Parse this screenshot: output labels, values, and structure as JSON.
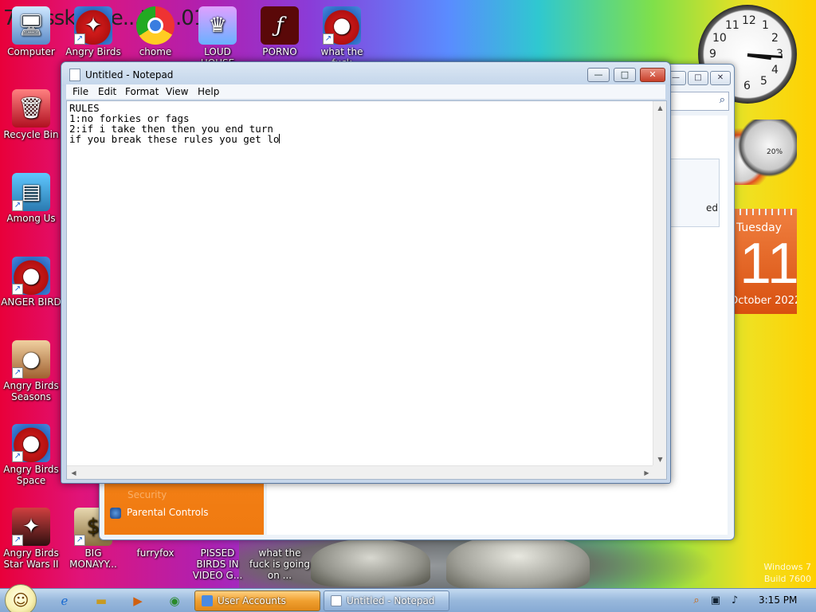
{
  "desktop": {
    "overlay_text": "7 Passkonae...tio...012",
    "icons": [
      {
        "label": "Computer",
        "icon": "computer-icon",
        "glyph": "🖥"
      },
      {
        "label": "Angry Birds",
        "icon": "angry-birds-star-wars-icon",
        "glyph": "✦",
        "badge": "STAR WARS"
      },
      {
        "label": "chome",
        "icon": "chrome-icon",
        "glyph": "◉"
      },
      {
        "label": "LOUD HOUSE",
        "icon": "loud-house-icon",
        "glyph": "♛"
      },
      {
        "label": "PORNO",
        "icon": "flash-icon",
        "glyph": "ƒ"
      },
      {
        "label": "what the fuck",
        "icon": "angry-birds-space-icon",
        "glyph": "●",
        "badge": "SPACE"
      },
      {
        "label": "Recycle Bin",
        "icon": "recycle-bin-icon",
        "glyph": "🗑"
      },
      {
        "label": "Among Us",
        "icon": "among-us-icon",
        "glyph": "▤"
      },
      {
        "label": "ANGER BIRD",
        "icon": "angry-birds-icon",
        "glyph": "●"
      },
      {
        "label": "Angry Birds Seasons",
        "icon": "angry-birds-seasons-icon",
        "glyph": "●",
        "badge": "SEASONS"
      },
      {
        "label": "Angry Birds Space",
        "icon": "angry-birds-space-icon",
        "glyph": "●",
        "badge": "SPACE"
      },
      {
        "label": "Angry Birds Star Wars II",
        "icon": "angry-birds-star-wars-2-icon",
        "glyph": "✦",
        "badge": "STAR WARS"
      },
      {
        "label": "BIG MONAYY...",
        "icon": "money-bag-icon",
        "glyph": "$"
      },
      {
        "label": "furryfox",
        "icon": "furryfox-icon",
        "glyph": "●"
      },
      {
        "label": "PISSED BIRDS IN VIDEO G...",
        "icon": "pissed-birds-icon",
        "glyph": "●"
      },
      {
        "label": "what the fuck is going on ...",
        "icon": "folder-icon",
        "glyph": "●"
      }
    ]
  },
  "gadgets": {
    "clock": {
      "numbers": [
        "12",
        "1",
        "2",
        "3",
        "4",
        "5",
        "6",
        "7",
        "8",
        "9",
        "10",
        "11"
      ]
    },
    "meter": {
      "percent": "20%"
    },
    "calendar": {
      "weekday": "Tuesday",
      "day": "11",
      "month_year": "October 2022"
    }
  },
  "back_window": {
    "side_link": "Parental Controls",
    "side_link_faded": "Security",
    "content_fragment": "ed"
  },
  "notepad": {
    "title": "Untitled - Notepad",
    "menu": [
      "File",
      "Edit",
      "Format",
      "View",
      "Help"
    ],
    "lines": [
      "RULES",
      "1:no forkies or fags",
      "2:if i take then then you end turn",
      "if you break these rules you get lo"
    ],
    "controls": {
      "minimize": "—",
      "maximize": "□",
      "close": "✕"
    }
  },
  "taskbar": {
    "tasks": [
      {
        "label": "User Accounts",
        "style": "orange"
      },
      {
        "label": "Untitled - Notepad",
        "style": "blue"
      }
    ],
    "time": "3:15 PM"
  },
  "watermark": {
    "line1": "Windows 7",
    "line2": "Build 7600"
  },
  "colors": {
    "accent_orange": "#f07a10",
    "titlebar": "#c3d5ea",
    "taskbar": "#98b8dc"
  }
}
